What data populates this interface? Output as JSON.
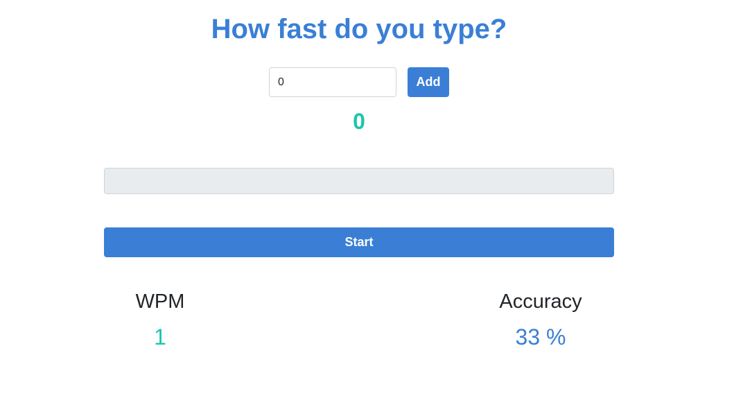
{
  "colors": {
    "primary": "#3a7fd5",
    "teal": "#1ac6ad",
    "text_dark": "#212529",
    "field_bg": "#e9ecef"
  },
  "header": {
    "title": "How fast do you type?"
  },
  "add_form": {
    "input_value": "0",
    "add_label": "Add"
  },
  "counter": {
    "value": "0"
  },
  "typing_area": {
    "value": ""
  },
  "start": {
    "label": "Start"
  },
  "stats": {
    "wpm": {
      "label": "WPM",
      "value": "1"
    },
    "accuracy": {
      "label": "Accuracy",
      "value": "33 %"
    }
  }
}
